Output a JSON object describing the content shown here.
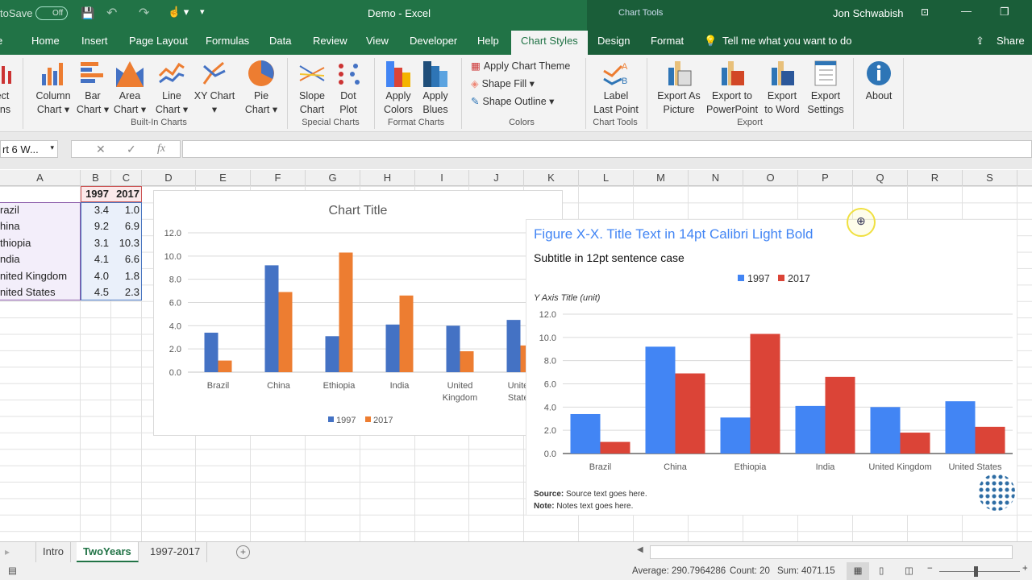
{
  "titlebar": {
    "autosave": "toSave",
    "autosave_state": "Off",
    "doc_title": "Demo  -  Excel",
    "context": "Chart Tools",
    "user": "Jon Schwabish"
  },
  "tabs": [
    "e",
    "Home",
    "Insert",
    "Page Layout",
    "Formulas",
    "Data",
    "Review",
    "View",
    "Developer",
    "Help",
    "Chart Styles",
    "Design",
    "Format"
  ],
  "tell_me": "Tell me what you want to do",
  "share": "Share",
  "ribbon": {
    "builtin": [
      {
        "l1": "ect",
        "l2": "ons"
      },
      {
        "l1": "Column",
        "l2": "Chart ▾"
      },
      {
        "l1": "Bar",
        "l2": "Chart ▾"
      },
      {
        "l1": "Area",
        "l2": "Chart ▾"
      },
      {
        "l1": "Line",
        "l2": "Chart ▾"
      },
      {
        "l1": "XY Chart",
        "l2": "▾"
      },
      {
        "l1": "Pie",
        "l2": "Chart ▾"
      }
    ],
    "builtin_group": "Built-In Charts",
    "special": [
      {
        "l1": "Slope",
        "l2": "Chart"
      },
      {
        "l1": "Dot",
        "l2": "Plot"
      }
    ],
    "special_group": "Special Charts",
    "format": [
      {
        "l1": "Apply",
        "l2": "Colors"
      },
      {
        "l1": "Apply",
        "l2": "Blues"
      }
    ],
    "format_group": "Format Charts",
    "colors": [
      "Apply Chart Theme",
      "Shape Fill ▾",
      "Shape Outline ▾"
    ],
    "colors_group": "Colors",
    "charttools": {
      "l1": "Label",
      "l2": "Last Point"
    },
    "charttools_group": "Chart Tools",
    "export": [
      {
        "l1": "Export As",
        "l2": "Picture"
      },
      {
        "l1": "Export to",
        "l2": "PowerPoint"
      },
      {
        "l1": "Export",
        "l2": "to Word"
      },
      {
        "l1": "Export",
        "l2": "Settings"
      }
    ],
    "export_group": "Export",
    "about": "About"
  },
  "formula_bar": {
    "name_box": "rt 6 W...",
    "fx": "fx",
    "value": ""
  },
  "columns": [
    "A",
    "B",
    "C",
    "D",
    "E",
    "F",
    "G",
    "H",
    "I",
    "J",
    "K",
    "L",
    "M",
    "N",
    "O",
    "P",
    "Q",
    "R",
    "S"
  ],
  "table": {
    "headers": [
      "1997",
      "2017"
    ],
    "rows": [
      [
        "razil",
        "3.4",
        "1.0"
      ],
      [
        "hina",
        "9.2",
        "6.9"
      ],
      [
        "thiopia",
        "3.1",
        "10.3"
      ],
      [
        "ndia",
        "4.1",
        "6.6"
      ],
      [
        "nited Kingdom",
        "4.0",
        "1.8"
      ],
      [
        "nited States",
        "4.5",
        "2.3"
      ]
    ]
  },
  "chart_data": [
    {
      "type": "bar",
      "title": "Chart Title",
      "categories": [
        "Brazil",
        "China",
        "Ethiopia",
        "India",
        "United Kingdom",
        "United States"
      ],
      "series": [
        {
          "name": "1997",
          "values": [
            3.4,
            9.2,
            3.1,
            4.1,
            4.0,
            4.5
          ],
          "color": "#4472c4"
        },
        {
          "name": "2017",
          "values": [
            1.0,
            6.9,
            10.3,
            6.6,
            1.8,
            2.3
          ],
          "color": "#ed7d31"
        }
      ],
      "yticks": [
        "0.0",
        "2.0",
        "4.0",
        "6.0",
        "8.0",
        "10.0",
        "12.0"
      ],
      "ylim": [
        0,
        12
      ],
      "grid": true,
      "legend": "bottom"
    },
    {
      "type": "bar",
      "title": "Figure X-X. Title Text in 14pt Calibri Light Bold",
      "subtitle": "Subtitle in 12pt sentence case",
      "ylabel": "Y Axis Title (unit)",
      "categories": [
        "Brazil",
        "China",
        "Ethiopia",
        "India",
        "United Kingdom",
        "United States"
      ],
      "series": [
        {
          "name": "1997",
          "values": [
            3.4,
            9.2,
            3.1,
            4.1,
            4.0,
            4.5
          ],
          "color": "#4285f4"
        },
        {
          "name": "2017",
          "values": [
            1.0,
            6.9,
            10.3,
            6.6,
            1.8,
            2.3
          ],
          "color": "#db4437"
        }
      ],
      "yticks": [
        "0.0",
        "2.0",
        "4.0",
        "6.0",
        "8.0",
        "10.0",
        "12.0"
      ],
      "ylim": [
        0,
        12
      ],
      "grid": true,
      "legend": "top",
      "source_label": "Source:",
      "source": " Source text goes here.",
      "note_label": "Note:",
      "note": " Notes text goes here.",
      "title_color": "#4285f4"
    }
  ],
  "sheets": [
    "Intro",
    "TwoYears",
    "1997-2017"
  ],
  "status": {
    "average": "Average: 290.7964286",
    "count": "Count: 20",
    "sum": "Sum: 4071.15"
  }
}
